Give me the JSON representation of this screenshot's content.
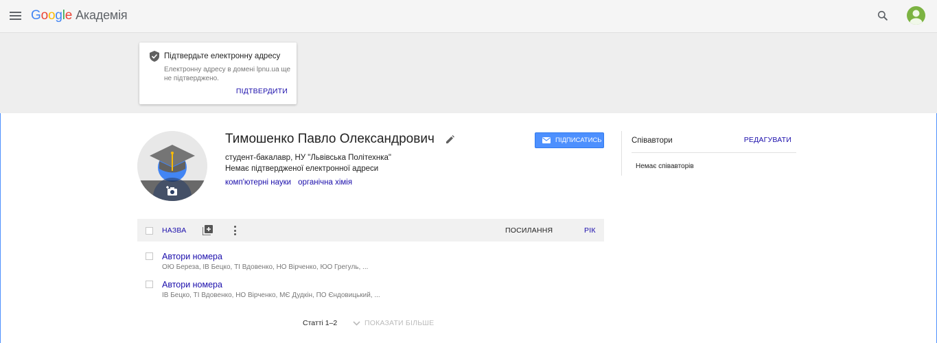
{
  "header": {
    "logo_parts": [
      "G",
      "o",
      "o",
      "g",
      "l",
      "e"
    ],
    "logo_sub": "Академія"
  },
  "verify_email": {
    "title": "Підтвердьте електронну адресу",
    "description": "Електронну адресу в домені lpnu.ua ще не підтверджено.",
    "confirm_label": "ПІДТВЕРДИТИ"
  },
  "profile": {
    "name": "Тимошенко Павло Олександрович",
    "affiliation": "студент-бакалавр, НУ \"Львівська Політехнка\"",
    "email_status": "Немає підтвердженої електронної адреси",
    "interests": [
      "комп'ютерні науки",
      "органічна хімія"
    ],
    "follow_label": "ПІДПИСАТИСЬ"
  },
  "coauthors": {
    "heading": "Співавтори",
    "edit_label": "РЕДАГУВАТИ",
    "empty_text": "Немає співавторів"
  },
  "table": {
    "col_title": "НАЗВА",
    "col_cited": "ПОСИЛАННЯ",
    "col_year": "РІК",
    "rows": [
      {
        "title": "Автори номера",
        "authors": "ОЮ Береза, ІВ Бецко, ТІ Вдовенко, НО Вірченко, ЮО Грегуль, ..."
      },
      {
        "title": "Автори номера",
        "authors": "ІВ Бецко, ТІ Вдовенко, НО Вірченко, МЄ Дудкін, ПО Єндовицький, ..."
      }
    ]
  },
  "footer": {
    "count": "Статті 1–2",
    "show_more_label": "ПОКАЗАТИ БІЛЬШЕ"
  },
  "colors": {
    "link": "#1a0dab",
    "button_blue": "#4d90fe",
    "banner_bg": "#eeeeee"
  }
}
